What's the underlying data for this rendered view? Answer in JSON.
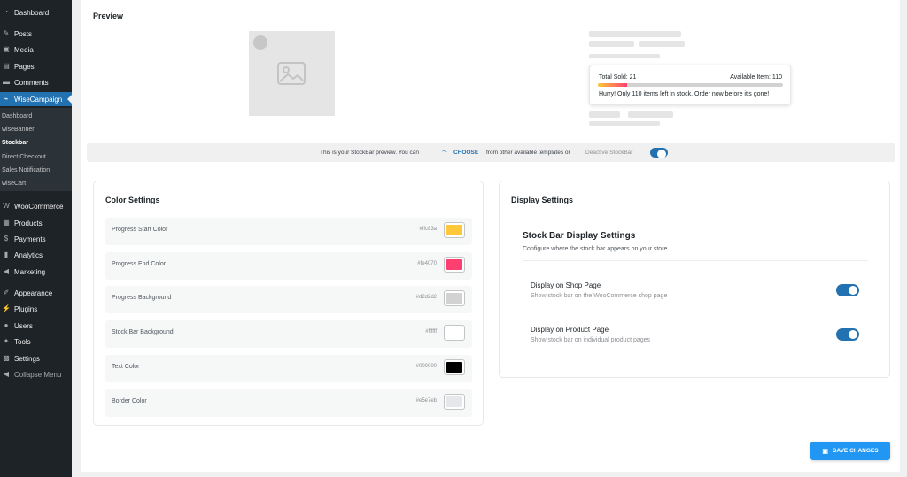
{
  "sidebar": {
    "items_top": [
      {
        "label": "Dashboard",
        "icon": "dashboard-icon",
        "glyph": "◔"
      },
      {
        "label": "Posts",
        "icon": "pin-icon",
        "glyph": "✎"
      },
      {
        "label": "Media",
        "icon": "media-icon",
        "glyph": "▣"
      },
      {
        "label": "Pages",
        "icon": "pages-icon",
        "glyph": "▤"
      },
      {
        "label": "Comments",
        "icon": "comments-icon",
        "glyph": "▬"
      },
      {
        "label": "WiseCampaign",
        "icon": "wisecampaign-icon",
        "glyph": "⌁"
      }
    ],
    "submenu": [
      "Dashboard",
      "wiseBanner",
      "Stockbar",
      "Direct Checkout",
      "Sales Notification",
      "wiseCart"
    ],
    "items_bottom": [
      {
        "label": "WooCommerce",
        "icon": "woocommerce-icon",
        "glyph": "W"
      },
      {
        "label": "Products",
        "icon": "products-icon",
        "glyph": "▦"
      },
      {
        "label": "Payments",
        "icon": "payments-icon",
        "glyph": "$"
      },
      {
        "label": "Analytics",
        "icon": "analytics-icon",
        "glyph": "▮"
      },
      {
        "label": "Marketing",
        "icon": "megaphone-icon",
        "glyph": "◀"
      },
      {
        "label": "Appearance",
        "icon": "appearance-icon",
        "glyph": "✐"
      },
      {
        "label": "Plugins",
        "icon": "plugins-icon",
        "glyph": "⚡"
      },
      {
        "label": "Users",
        "icon": "users-icon",
        "glyph": "●"
      },
      {
        "label": "Tools",
        "icon": "tools-icon",
        "glyph": "✦"
      },
      {
        "label": "Settings",
        "icon": "settings-icon",
        "glyph": "▩"
      },
      {
        "label": "Collapse Menu",
        "icon": "collapse-icon",
        "glyph": "◀"
      }
    ]
  },
  "preview": {
    "title": "Preview",
    "total_sold": "Total Sold: 21",
    "available": "Available Item: 110",
    "message": "Hurry! Only 110 items left in stock. Order now before it's gone!",
    "progress_fraction": 0.16,
    "info_prefix": "This is your StockBar preview. You can",
    "choose_label": "CHOOSE",
    "info_suffix": "from other available templates or",
    "deactivate_label": "Deactive StockBar"
  },
  "color_settings": {
    "title": "Color Settings",
    "rows": [
      {
        "label": "Progress Start Color",
        "hex": "#ffc83a",
        "color": "#ffc83a"
      },
      {
        "label": "Progress End Color",
        "hex": "#fe4070",
        "color": "#fe4070"
      },
      {
        "label": "Progress Background",
        "hex": "#d2d2d2",
        "color": "#d2d2d2"
      },
      {
        "label": "Stock Bar Background",
        "hex": "#ffffff",
        "color": "#ffffff"
      },
      {
        "label": "Text Color",
        "hex": "#000000",
        "color": "#000000"
      },
      {
        "label": "Border Color",
        "hex": "#e5e7eb",
        "color": "#e5e7eb"
      }
    ]
  },
  "display_settings": {
    "title": "Display Settings",
    "subtitle": "Stock Bar Display Settings",
    "description": "Configure where the stock bar appears on your store",
    "options": [
      {
        "label": "Display on Shop Page",
        "help": "Show stock bar on the WooCommerce shop page",
        "enabled": true
      },
      {
        "label": "Display on Product Page",
        "help": "Show stock bar on individual product pages",
        "enabled": true
      }
    ]
  },
  "save_button": {
    "label": "SAVE CHANGES"
  },
  "colors": {
    "accent": "#2271b1",
    "button": "#2196f3"
  }
}
